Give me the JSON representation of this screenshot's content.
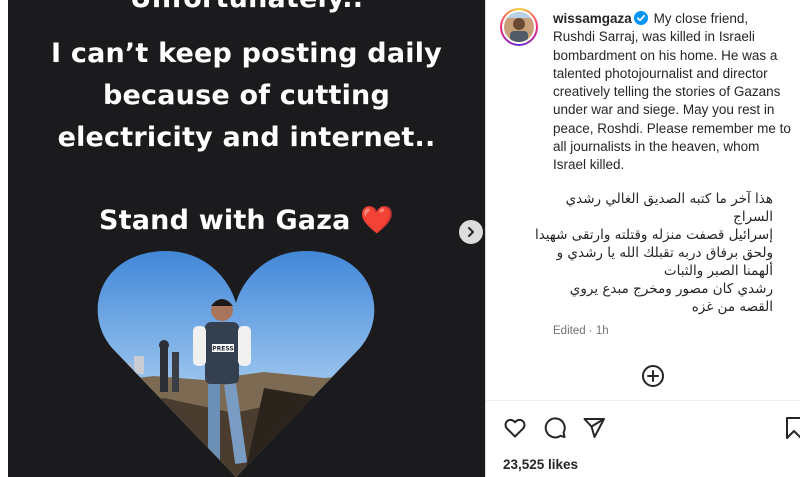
{
  "story": {
    "line1": "Unfortunately..",
    "line2": "I can’t keep posting daily",
    "line3": "because of cutting",
    "line4": "electricity and internet..",
    "line5": "Stand with Gaza ❤️",
    "press_label": "PRESS"
  },
  "post": {
    "username": "wissamgaza",
    "caption_en": "My close friend, Rushdi Sarraj, was killed in Israeli bombardment on his home. He was a talented photojournalist and director creatively telling the stories of Gazans under war and siege. May you rest in peace, Roshdi. Please remember me to all journalists in the heaven, whom Israel killed.",
    "caption_ar": [
      "هذا آخر ما كتبه الصديق الغالي رشدي",
      "السراج",
      "إسرائيل قصفت منزله وقتلته وارتقى شهيدا",
      "ولحق برفاق دربه تقبلك الله يا رشدي و",
      "ألهمنا الصبر والثبات",
      "رشدي كان مصور ومخرج مبدع يروي",
      "القصه من غزه"
    ],
    "edited": "Edited · 1h",
    "likes": "23,525 likes"
  },
  "colors": {
    "media_bg": "#1b1b1d",
    "verified": "#0095f6",
    "text": "#262626",
    "muted": "#737373"
  },
  "icons": {
    "next": "chevron-right-icon",
    "add_comment": "plus-circle-icon",
    "like": "heart-outline-icon",
    "comment": "comment-bubble-icon",
    "share": "paper-plane-icon",
    "save": "bookmark-icon"
  }
}
